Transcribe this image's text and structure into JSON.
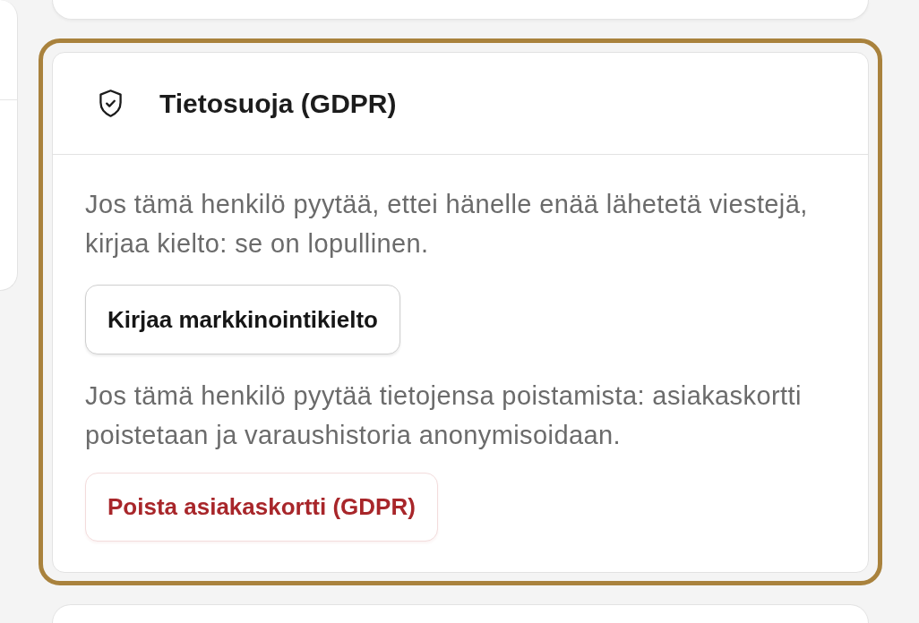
{
  "card": {
    "highlighted": true,
    "title": "Tietosuoja (GDPR)",
    "sections": [
      {
        "text": "Jos tämä henkilö pyytää, ettei hänelle enää lähetetä viestejä, kirjaa kielto: se on lopullinen.",
        "button": {
          "label": "Kirjaa markkinointikielto",
          "kind": "default"
        }
      },
      {
        "text": "Jos tämä henkilö pyytää tietojensa poistamista: asiakaskortti poistetaan ja varaushistoria anonymisoidaan.",
        "button": {
          "label": "Poista asiakaskortti (GDPR)",
          "kind": "danger"
        }
      }
    ]
  }
}
